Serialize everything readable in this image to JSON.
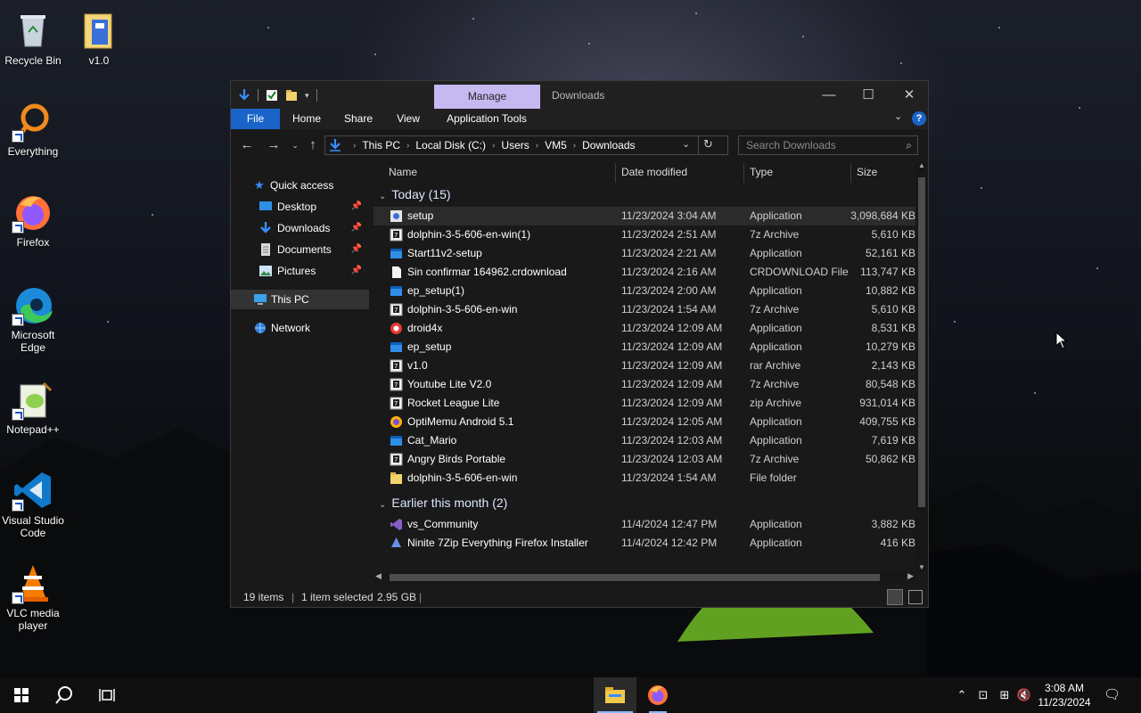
{
  "desktop": {
    "icons": [
      {
        "label": "Recycle Bin"
      },
      {
        "label": "v1.0"
      },
      {
        "label": "Everything"
      },
      {
        "label": "Firefox"
      },
      {
        "label": "Microsoft Edge"
      },
      {
        "label": "Notepad++"
      },
      {
        "label": "Visual Studio Code"
      },
      {
        "label": "VLC media player"
      }
    ]
  },
  "window": {
    "context_tab": "Manage",
    "title": "Downloads",
    "ribbon_tabs": [
      "File",
      "Home",
      "Share",
      "View",
      "Application Tools"
    ],
    "breadcrumb": [
      "This PC",
      "Local Disk (C:)",
      "Users",
      "VM5",
      "Downloads"
    ],
    "search_placeholder": "Search Downloads",
    "nav": {
      "quick_access": "Quick access",
      "items": [
        "Desktop",
        "Downloads",
        "Documents",
        "Pictures"
      ],
      "this_pc": "This PC",
      "network": "Network"
    },
    "columns": {
      "name": "Name",
      "date": "Date modified",
      "type": "Type",
      "size": "Size"
    },
    "groups": [
      {
        "label": "Today (15)",
        "rows": [
          {
            "name": "setup",
            "date": "11/23/2024 3:04 AM",
            "type": "Application",
            "size": "3,098,684 KB",
            "icon": "setup-icon"
          },
          {
            "name": "dolphin-3-5-606-en-win(1)",
            "date": "11/23/2024 2:51 AM",
            "type": "7z Archive",
            "size": "5,610 KB",
            "icon": "archive-icon"
          },
          {
            "name": "Start11v2-setup",
            "date": "11/23/2024 2:21 AM",
            "type": "Application",
            "size": "52,161 KB",
            "icon": "app-icon"
          },
          {
            "name": "Sin confirmar 164962.crdownload",
            "date": "11/23/2024 2:16 AM",
            "type": "CRDOWNLOAD File",
            "size": "113,747 KB",
            "icon": "file-icon"
          },
          {
            "name": "ep_setup(1)",
            "date": "11/23/2024 2:00 AM",
            "type": "Application",
            "size": "10,882 KB",
            "icon": "app-icon"
          },
          {
            "name": "dolphin-3-5-606-en-win",
            "date": "11/23/2024 1:54 AM",
            "type": "7z Archive",
            "size": "5,610 KB",
            "icon": "archive-icon"
          },
          {
            "name": "droid4x",
            "date": "11/23/2024 12:09 AM",
            "type": "Application",
            "size": "8,531 KB",
            "icon": "droid-icon"
          },
          {
            "name": "ep_setup",
            "date": "11/23/2024 12:09 AM",
            "type": "Application",
            "size": "10,279 KB",
            "icon": "app-icon"
          },
          {
            "name": "v1.0",
            "date": "11/23/2024 12:09 AM",
            "type": "rar Archive",
            "size": "2,143 KB",
            "icon": "archive-icon"
          },
          {
            "name": "Youtube Lite V2.0",
            "date": "11/23/2024 12:09 AM",
            "type": "7z Archive",
            "size": "80,548 KB",
            "icon": "archive-icon"
          },
          {
            "name": "Rocket League Lite",
            "date": "11/23/2024 12:09 AM",
            "type": "zip Archive",
            "size": "931,014 KB",
            "icon": "archive-icon"
          },
          {
            "name": "OptiMemu Android 5.1",
            "date": "11/23/2024 12:05 AM",
            "type": "Application",
            "size": "409,755 KB",
            "icon": "optimemu-icon"
          },
          {
            "name": "Cat_Mario",
            "date": "11/23/2024 12:03 AM",
            "type": "Application",
            "size": "7,619 KB",
            "icon": "app-icon"
          },
          {
            "name": "Angry Birds Portable",
            "date": "11/23/2024 12:03 AM",
            "type": "7z Archive",
            "size": "50,862 KB",
            "icon": "archive-icon"
          },
          {
            "name": "dolphin-3-5-606-en-win",
            "date": "11/23/2024 1:54 AM",
            "type": "File folder",
            "size": "",
            "icon": "folder-icon"
          }
        ]
      },
      {
        "label": "Earlier this month (2)",
        "rows": [
          {
            "name": "vs_Community",
            "date": "11/4/2024 12:47 PM",
            "type": "Application",
            "size": "3,882 KB",
            "icon": "vs-icon"
          },
          {
            "name": "Ninite 7Zip Everything Firefox Installer",
            "date": "11/4/2024 12:42 PM",
            "type": "Application",
            "size": "416 KB",
            "icon": "ninite-icon"
          }
        ]
      }
    ],
    "status": {
      "items": "19 items",
      "selected": "1 item selected",
      "size": "2.95 GB"
    }
  },
  "taskbar": {
    "time": "3:08 AM",
    "date": "11/23/2024"
  },
  "colors": {
    "accent": "#1a64c9",
    "manage_tab": "#c6b8f0"
  }
}
